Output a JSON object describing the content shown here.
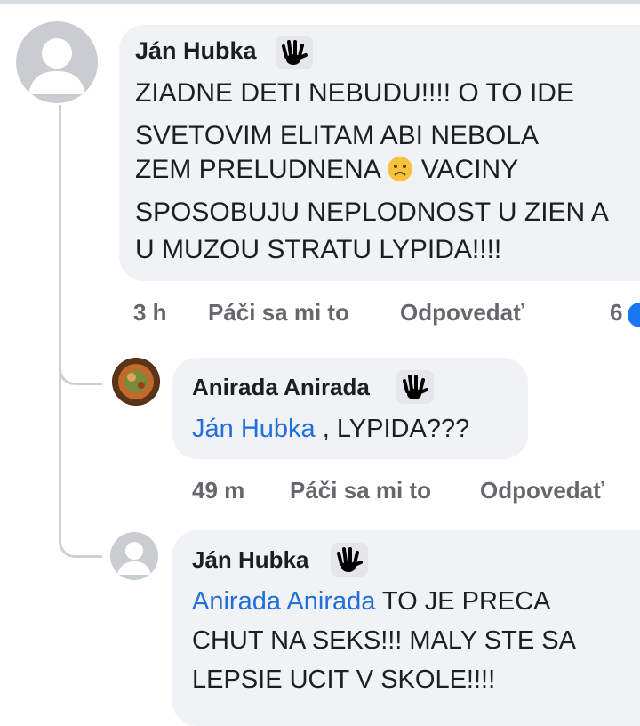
{
  "comments": [
    {
      "author": "Ján Hubka",
      "lines": [
        "ZIADNE DETI NEBUDU!!!! O TO IDE",
        "SVETOVIM ELITAM ABI NEBOLA",
        "ZEM PRELUDNENA",
        "VACINY",
        "SPOSOBUJU NEPLODNOST U ZIEN A",
        "U MUZOU STRATU LYPIDA!!!!"
      ],
      "time": "3 h",
      "like": "Páči sa mi to",
      "reply": "Odpovedať",
      "reaction_count": "6"
    },
    {
      "author": "Anirada Anirada",
      "mention": "Ján Hubka",
      "text": " , LYPIDA???",
      "time": "49 m",
      "like": "Páči sa mi to",
      "reply": "Odpovedať"
    },
    {
      "author": "Ján Hubka",
      "mention": "Anirada Anirada",
      "line1": " TO JE PRECA",
      "line2": "CHUT NA SEKS!!! MALY STE SA",
      "line3": "LEPSIE UCIT V SKOLE!!!!"
    }
  ],
  "icons": {
    "badge": "waving-hand-icon",
    "emoji": "worried-face-icon",
    "avatar_default": "default-user-avatar-icon",
    "avatar_photo": "user-photo-avatar"
  },
  "colors": {
    "bubble": "#f0f2f5",
    "mention": "#216fdb",
    "meta": "#65676b",
    "reaction": "#1877f2"
  }
}
